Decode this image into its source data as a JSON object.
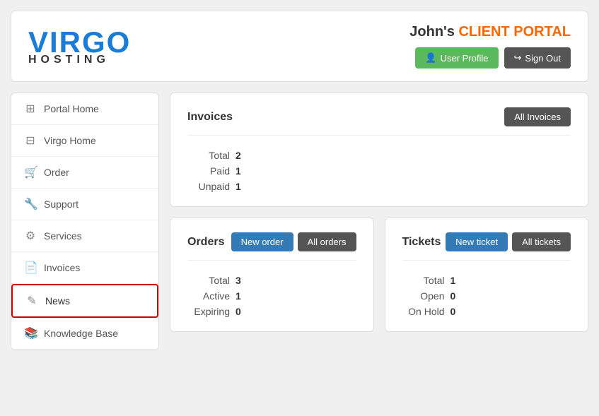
{
  "header": {
    "logo_virgo": "VIRGO",
    "logo_hosting": "HOSTING",
    "portal_greeting": "John's",
    "portal_title": "CLIENT PORTAL",
    "btn_profile_label": "User Profile",
    "btn_signout_label": "Sign Out"
  },
  "sidebar": {
    "items": [
      {
        "id": "portal-home",
        "label": "Portal Home",
        "icon": "⊞"
      },
      {
        "id": "virgo-home",
        "label": "Virgo Home",
        "icon": "⊟"
      },
      {
        "id": "order",
        "label": "Order",
        "icon": "🛒"
      },
      {
        "id": "support",
        "label": "Support",
        "icon": "🔧"
      },
      {
        "id": "services",
        "label": "Services",
        "icon": "⚙"
      },
      {
        "id": "invoices",
        "label": "Invoices",
        "icon": "📄"
      },
      {
        "id": "news",
        "label": "News",
        "icon": "✎",
        "active": true
      },
      {
        "id": "knowledge-base",
        "label": "Knowledge Base",
        "icon": "📚"
      }
    ]
  },
  "invoices": {
    "title": "Invoices",
    "btn_all": "All Invoices",
    "stats": [
      {
        "label": "Total",
        "value": "2"
      },
      {
        "label": "Paid",
        "value": "1"
      },
      {
        "label": "Unpaid",
        "value": "1"
      }
    ]
  },
  "orders": {
    "title": "Orders",
    "btn_new": "New order",
    "btn_all": "All orders",
    "stats": [
      {
        "label": "Total",
        "value": "3"
      },
      {
        "label": "Active",
        "value": "1"
      },
      {
        "label": "Expiring",
        "value": "0"
      }
    ]
  },
  "tickets": {
    "title": "Tickets",
    "btn_new": "New ticket",
    "btn_all": "All tickets",
    "stats": [
      {
        "label": "Total",
        "value": "1"
      },
      {
        "label": "Open",
        "value": "0"
      },
      {
        "label": "On Hold",
        "value": "0"
      }
    ]
  }
}
